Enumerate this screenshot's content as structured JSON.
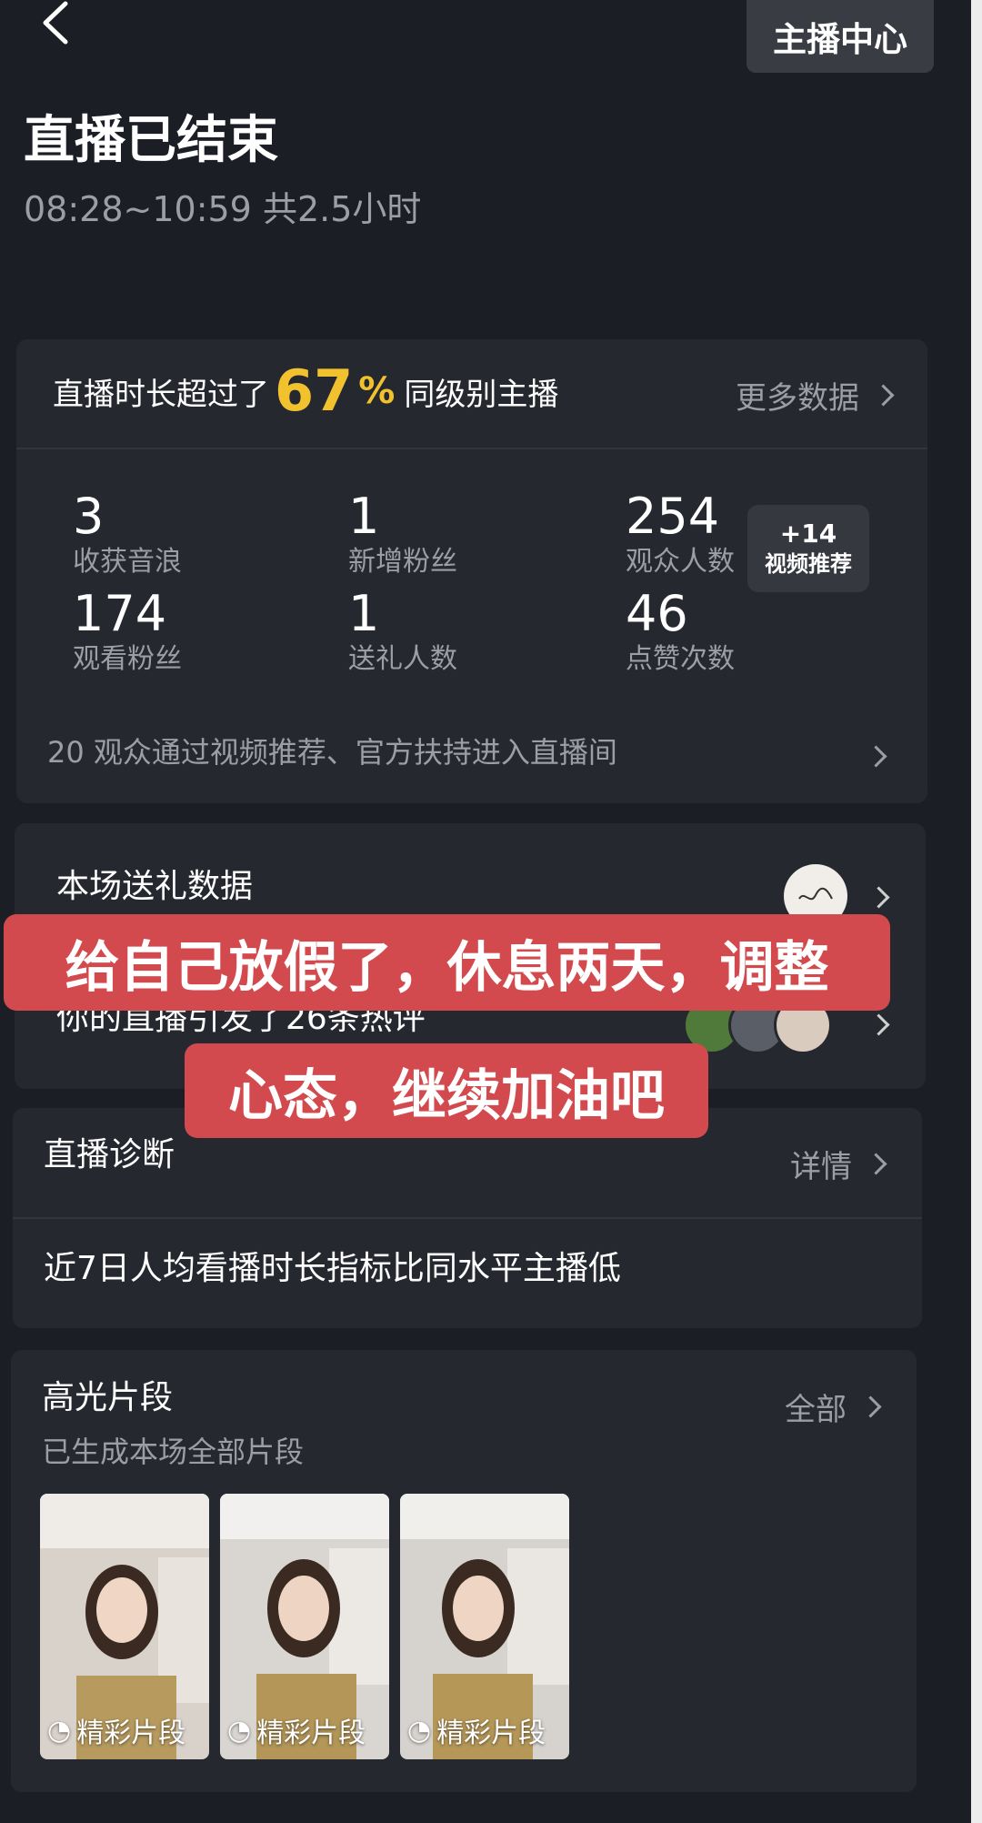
{
  "header": {
    "host_center_label": "主播中心",
    "title": "直播已结束",
    "time_range": "08:28~10:59 共2.5小时"
  },
  "stats": {
    "headline_prefix": "直播时长超过了",
    "headline_pct": "67",
    "headline_pct_sign": "%",
    "headline_suffix": "同级别主播",
    "more_label": "更多数据",
    "items": [
      {
        "value": "3",
        "label": "收获音浪"
      },
      {
        "value": "1",
        "label": "新增粉丝"
      },
      {
        "value": "254",
        "label": "观众人数"
      },
      {
        "value": "174",
        "label": "观看粉丝"
      },
      {
        "value": "1",
        "label": "送礼人数"
      },
      {
        "value": "46",
        "label": "点赞次数"
      }
    ],
    "boost_value": "+14",
    "boost_label": "视频推荐",
    "recommend_text": "20 观众通过视频推荐、官方扶持进入直播间"
  },
  "gift": {
    "title": "本场送礼数据",
    "comments_text": "你的直播引发了26条热评"
  },
  "captions": {
    "line1": "给自己放假了，休息两天，调整",
    "line2": "心态，继续加油吧"
  },
  "diagnosis": {
    "title": "直播诊断",
    "more_label": "详情",
    "text": "近7日人均看播时长指标比同水平主播低"
  },
  "highlights": {
    "title": "高光片段",
    "subtitle": "已生成本场全部片段",
    "more_label": "全部",
    "clips": [
      {
        "label": "精彩片段"
      },
      {
        "label": "精彩片段"
      },
      {
        "label": "精彩片段"
      }
    ]
  }
}
